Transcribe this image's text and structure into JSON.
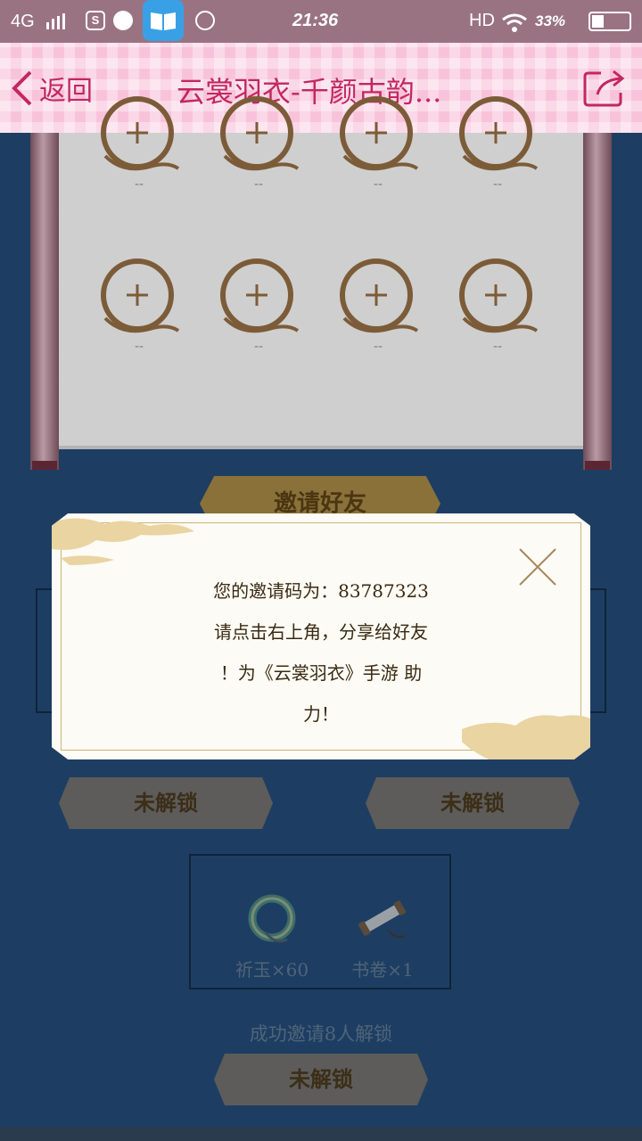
{
  "status_bar": {
    "carrier": "4G",
    "s_app": "S",
    "time": "21:36",
    "network": "HD",
    "battery": "33%"
  },
  "header": {
    "back_label": "返回",
    "title": "云裳羽衣-千颜古韵..."
  },
  "scroll": {
    "slot_placeholder": "--"
  },
  "page": {
    "invite_banner": "邀请好友",
    "unlock_left": "未解锁",
    "unlock_right": "未解锁",
    "unlock_bottom": "未解锁",
    "rewards": [
      {
        "label": "祈玉×60",
        "icon": "jade-icon"
      },
      {
        "label": "书卷×1",
        "icon": "scroll-icon"
      }
    ],
    "unlock_caption": "成功邀请8人解锁"
  },
  "dialog": {
    "line1": "您的邀请码为：83787323",
    "line2": "请点击右上角，分享给好友",
    "line3": "！为《云裳羽衣》手游 助",
    "line4": "力！"
  },
  "colors": {
    "header_bg": "#f8c3da",
    "header_text": "#c2285f",
    "page_bg": "#1d3e62",
    "dialog_bg": "#fdfbf5"
  }
}
